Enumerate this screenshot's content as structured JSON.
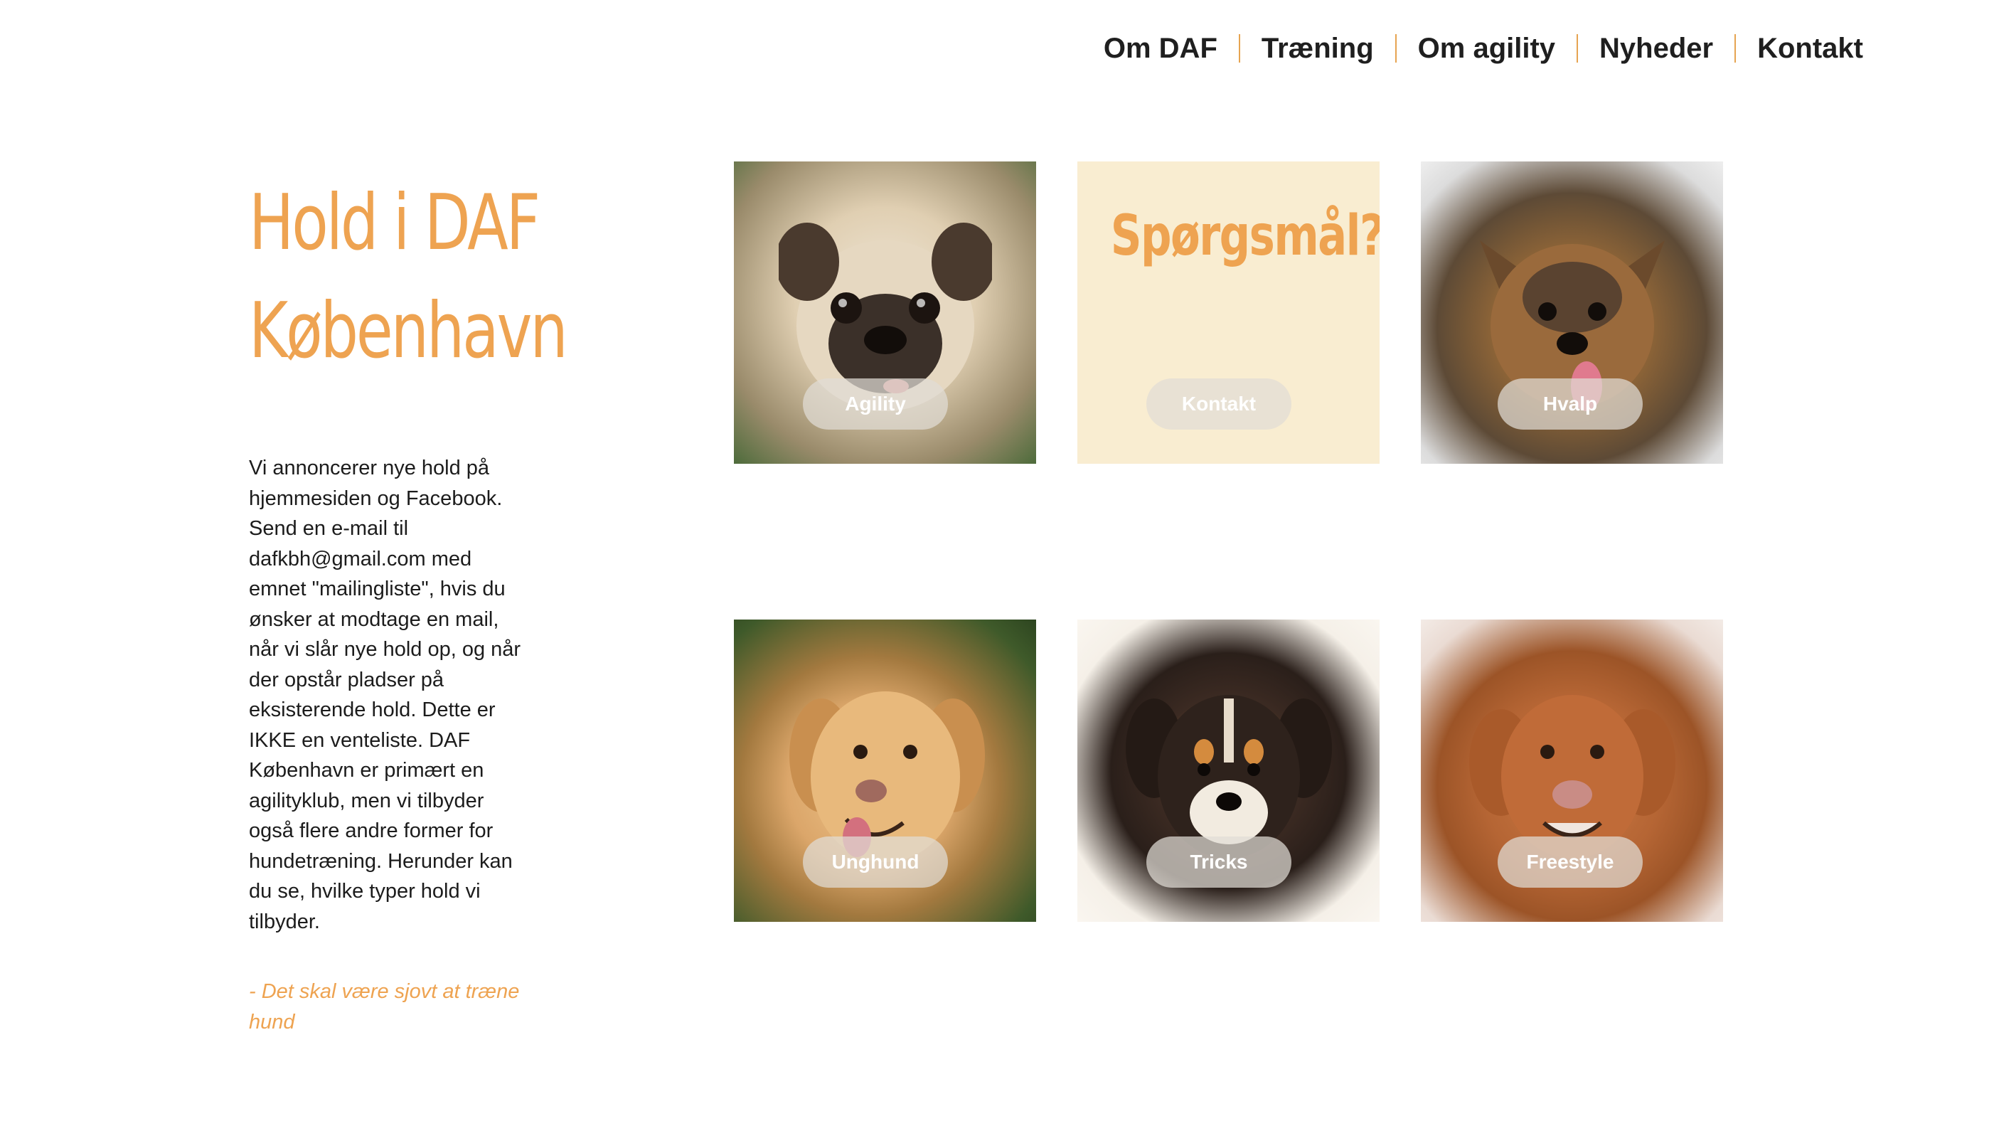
{
  "nav": {
    "items": [
      "Om DAF",
      "Træning",
      "Om agility",
      "Nyheder",
      "Kontakt"
    ]
  },
  "main": {
    "heading_line1": "Hold i DAF",
    "heading_line2": "København",
    "intro": "Vi annoncerer nye hold på hjemmesiden og Facebook. Send en e-mail til dafkbh@gmail.com med emnet \"mailingliste\", hvis du ønsker at modtage en mail, når vi slår nye hold op, og når der opstår pladser på eksisterende hold. Dette er IKKE en venteliste. DAF København er primært en agilityklub, men vi tilbyder også flere andre former for hundetræning. Herunder kan du se, hvilke typer hold vi tilbyder.",
    "motto": "- Det skal være sjovt at træne hund"
  },
  "tiles": {
    "question": "Spørgsmål?",
    "buttons": [
      "Agility",
      "Kontakt",
      "Hvalp",
      "Unghund",
      "Tricks",
      "Freestyle"
    ],
    "image_icons": [
      "pug-dog-photo",
      "yorkshire-terrier-photo",
      "golden-retriever-photo",
      "puppy-photo",
      "duck-toller-photo"
    ]
  },
  "colors": {
    "accent": "#eea351",
    "question_bg": "#f9edd1",
    "text": "#1c1c1c",
    "nav_separator": "#e6a451"
  }
}
